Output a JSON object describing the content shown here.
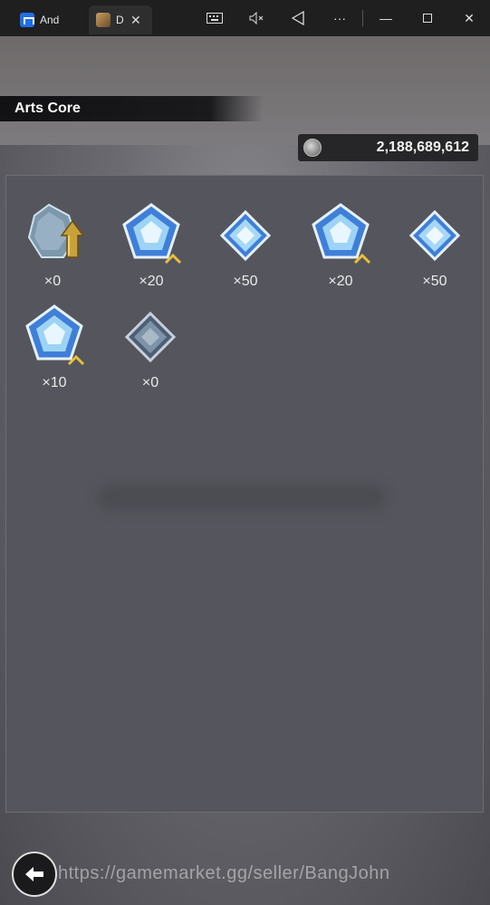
{
  "window": {
    "tabs": [
      {
        "label": "Andr"
      },
      {
        "label": "D"
      }
    ]
  },
  "header": {
    "title": "Arts Core"
  },
  "currency": {
    "icon": "coin-icon",
    "value": "2,188,689,612"
  },
  "items": [
    {
      "name": "upgrade-crystal",
      "qty": "×0"
    },
    {
      "name": "pentagon-crystal-plus",
      "qty": "×20"
    },
    {
      "name": "diamond-crystal",
      "qty": "×50"
    },
    {
      "name": "pentagon-crystal-plus",
      "qty": "×20"
    },
    {
      "name": "diamond-crystal",
      "qty": "×50"
    },
    {
      "name": "pentagon-crystal-plus",
      "qty": "×10"
    },
    {
      "name": "diamond-crystal-grey",
      "qty": "×0"
    }
  ],
  "watermark": "https://gamemarket.gg/seller/BangJohn"
}
